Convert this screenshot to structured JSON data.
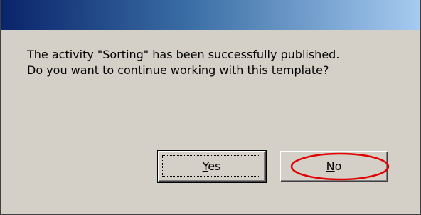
{
  "dialog": {
    "message_line1": "The activity \"Sorting\" has been successfully published.",
    "message_line2": "Do you want to continue working with this template?"
  },
  "buttons": {
    "yes": {
      "mnemonic": "Y",
      "rest": "es"
    },
    "no": {
      "mnemonic": "N",
      "rest": "o"
    }
  },
  "colors": {
    "dialog_bg": "#d4d0c8",
    "titlebar_start": "#0a246a",
    "titlebar_end": "#a6caf0",
    "annotation": "#e00000"
  }
}
